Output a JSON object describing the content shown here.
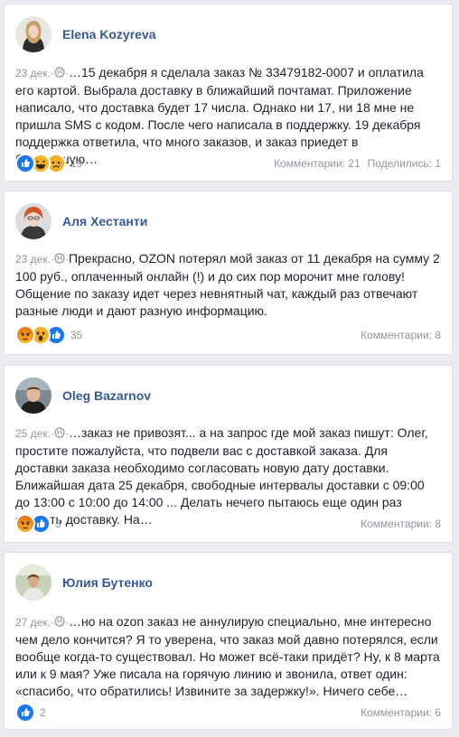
{
  "posts": [
    {
      "author": "Elena Kozyreva",
      "date": "23 дек.",
      "separator": "·",
      "text": "…15 декабря я сделала заказ № 33479182-0007 и оплатила его картой. Выбрала доставку в ближайший почтамат. Приложение написало, что доставка будет 17 числа. Однако ни 17, ни 18 мне не пришла SMS с кодом. После чего написала в поддержку. 19 декабря поддержка ответила, что много заказов, и заказ приедет в ближайшую…",
      "reactions": [
        "like-icon",
        "haha-icon",
        "sad-icon"
      ],
      "reaction_count": "19",
      "comments": "Комментарии: 21",
      "shares": "Поделились: 1"
    },
    {
      "author": "Аля Хестанти",
      "date": "23 дек.",
      "separator": "·",
      "text": "Прекрасно, OZON потерял мой заказ от 11 декабря на сумму 2 100 руб., оплаченный онлайн (!) и до сих пор морочит мне голову! Общение по заказу идет через невнятный чат, каждый раз отвечают разные люди и дают разную информацию.",
      "reactions": [
        "angry-icon",
        "wow-icon",
        "like-icon"
      ],
      "reaction_count": "35",
      "comments": "Комментарии: 8",
      "shares": ""
    },
    {
      "author": "Oleg Bazarnov",
      "date": "25 дек.",
      "separator": "·",
      "text": "…заказ не привозят... а на запрос где мой заказ пишут: Олег, простите пожалуйста, что подвели вас с доставкой заказа. Для доставки заказа необходимо согласовать новую дату доставки. Ближайшая дата 25 декабря, свободные интервалы доставки с 09:00 до 13:00 с 10:00 до 14:00 ... Делать нечего пытаюсь еще один раз сделать доставку. На…",
      "reactions": [
        "angry-icon",
        "like-icon"
      ],
      "reaction_count": "3",
      "comments": "Комментарии: 8",
      "shares": ""
    },
    {
      "author": "Юлия Бутенко",
      "date": "27 дек.",
      "separator": "·",
      "text": "…но на ozon заказ не аннулирую специально, мне интересно чем дело кончится? Я то уверена, что заказ мой давно потерялся, если вообще когда-то существовал. Но может всё-таки придёт? Ну, к 8 марта или к 9 мая? Уже писала на горячую линию и звонила, ответ один: «спасибо, что обратились! Извините за задержку!». Ничего себе…",
      "reactions": [
        "like-icon"
      ],
      "reaction_count": "2",
      "comments": "Комментарии: 6",
      "shares": ""
    }
  ],
  "colors": {
    "background": "#e9ebee",
    "card": "#ffffff",
    "author_link": "#365899",
    "meta": "#90949c",
    "text": "#1d2129",
    "like": "#1877f2",
    "angry": "#e9710f",
    "emoji_yellow": "#f7b125"
  }
}
